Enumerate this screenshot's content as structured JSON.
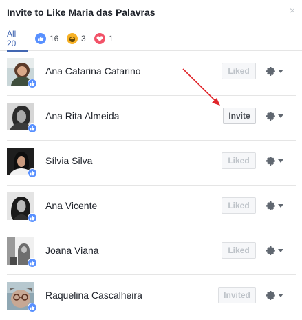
{
  "dialog": {
    "title": "Invite to Like Maria das Palavras",
    "close_glyph": "×"
  },
  "tabs": [
    {
      "label": "All 20",
      "active": true
    },
    {
      "icon": "like-icon",
      "count": "16",
      "color": "#5890ff"
    },
    {
      "icon": "haha-icon",
      "count": "3",
      "color": "#f7b125"
    },
    {
      "icon": "love-icon",
      "count": "1",
      "color": "#f25268"
    }
  ],
  "people": [
    {
      "name": "Ana Catarina Catarino",
      "status": "Liked",
      "status_state": "disabled"
    },
    {
      "name": "Ana Rita Almeida",
      "status": "Invite",
      "status_state": "active"
    },
    {
      "name": "Sílvia Silva",
      "status": "Liked",
      "status_state": "disabled"
    },
    {
      "name": "Ana Vicente",
      "status": "Liked",
      "status_state": "disabled"
    },
    {
      "name": "Joana Viana",
      "status": "Liked",
      "status_state": "disabled"
    },
    {
      "name": "Raquelina Cascalheira",
      "status": "Invited",
      "status_state": "disabled"
    }
  ],
  "colors": {
    "accent": "#4267b2",
    "like_badge": "#5890ff",
    "annotation_arrow": "#e0262b"
  }
}
